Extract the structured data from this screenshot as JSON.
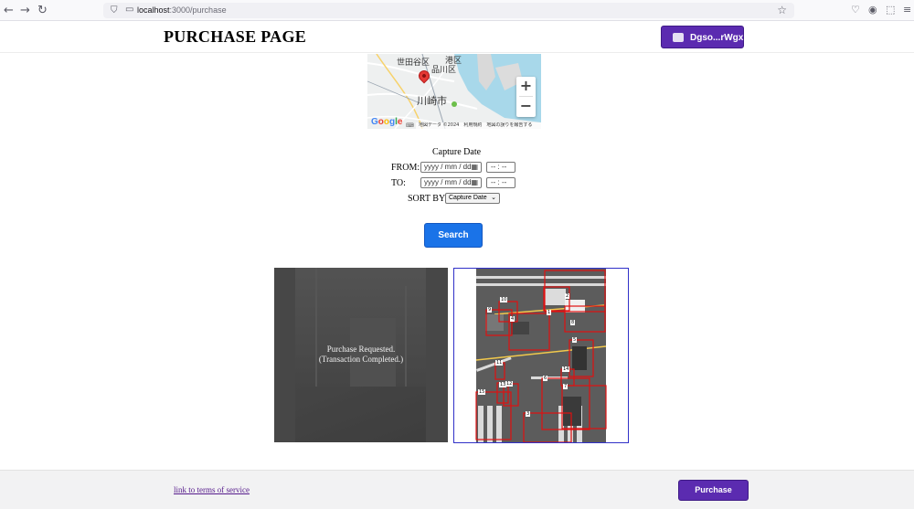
{
  "browser": {
    "url_host": "localhost",
    "url_path": ":3000/purchase",
    "back_icon": "arrow-left-icon",
    "forward_icon": "arrow-right-icon",
    "reload_icon": "reload-icon"
  },
  "header": {
    "title": "PURCHASE PAGE",
    "wallet_label": "Dgso...rWgx"
  },
  "map": {
    "labels": [
      "世田谷区",
      "港区",
      "品川区",
      "川崎市"
    ],
    "zoom_in": "+",
    "zoom_out": "−",
    "logo": "Google",
    "attribution": "地図データ ©2024　利用規約　地図の誤りを報告する"
  },
  "filters": {
    "heading": "Capture Date",
    "from_label": "FROM:",
    "to_label": "TO:",
    "date_placeholder": "yyyy / mm / dd",
    "time_placeholder": "-- : --",
    "sort_label": "SORT BY:",
    "sort_value": "Capture Date"
  },
  "search_button": "Search",
  "results": [
    {
      "status_line1": "Purchase Requested.",
      "status_line2": "(Transaction Completed.)"
    },
    {
      "box_labels": [
        "10",
        "2",
        "9",
        "4",
        "1",
        "8",
        "5",
        "14",
        "11",
        "13",
        "12",
        "15",
        "6",
        "7",
        "3"
      ]
    }
  ],
  "footer": {
    "terms_link": "link to terms of service",
    "purchase_button": "Purchase"
  },
  "colors": {
    "primary_purple": "#5b2bb0",
    "search_blue": "#1a73e8",
    "detection_red": "#e01010",
    "selected_border": "#3030c8"
  }
}
